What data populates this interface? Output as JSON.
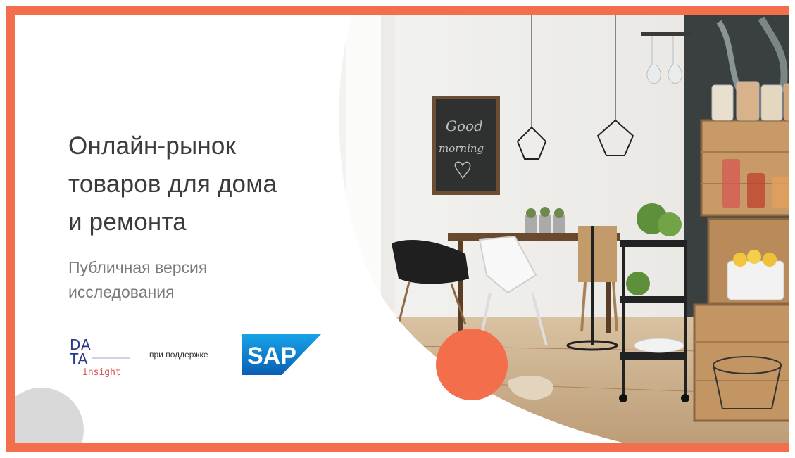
{
  "slide": {
    "title_lines": [
      "Онлайн-рынок",
      "товаров для дома",
      "и ремонта"
    ],
    "subtitle_lines": [
      "Публичная версия",
      "исследования"
    ],
    "sponsor_label": "при поддержке",
    "logos": {
      "data_insight": {
        "line1": "DA",
        "line2": "TA",
        "line3": "insight"
      },
      "sap": {
        "text": "SAP",
        "mark": "®"
      }
    },
    "colors": {
      "accent": "#f36f4c",
      "title": "#3b3b3b",
      "subtitle": "#7a7a7a",
      "sap_blue": "#0a6ed1"
    },
    "photo_description_icon": "kitchen-interior-photo"
  }
}
